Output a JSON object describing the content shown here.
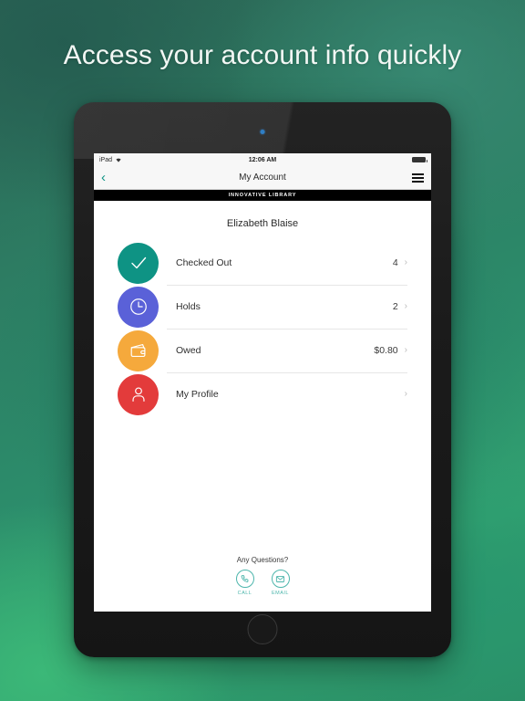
{
  "headline": "Access your account info quickly",
  "device": {
    "camera": "camera-dot",
    "home_button": "home-button"
  },
  "screen": {
    "status_bar": {
      "carrier": "iPad",
      "wifi_icon": "wifi-icon",
      "time": "12:06 AM",
      "battery_icon": "battery-icon"
    },
    "nav_bar": {
      "back_icon": "chevron-left-icon",
      "title": "My Account",
      "menu_icon": "hamburger-menu-icon",
      "back_color": "#0e9384"
    },
    "brand_bar": {
      "label": "INNOVATIVE LIBRARY"
    },
    "user": {
      "name": "Elizabeth Blaise"
    },
    "rows": [
      {
        "label": "Checked Out",
        "value": "4",
        "icon": "check-icon",
        "color": "#0e9384",
        "chevron": "›"
      },
      {
        "label": "Holds",
        "value": "2",
        "icon": "clock-icon",
        "color": "#5a61d8",
        "chevron": "›"
      },
      {
        "label": "Owed",
        "value": "$0.80",
        "icon": "wallet-icon",
        "color": "#f5a93c",
        "chevron": "›"
      },
      {
        "label": "My Profile",
        "value": "",
        "icon": "person-icon",
        "color": "#e33b3b",
        "chevron": "›"
      }
    ],
    "footer": {
      "title": "Any Questions?",
      "actions": [
        {
          "label": "CALL",
          "icon": "phone-icon"
        },
        {
          "label": "EMAIL",
          "icon": "envelope-icon"
        }
      ],
      "accent_color": "#4db6ac"
    }
  }
}
